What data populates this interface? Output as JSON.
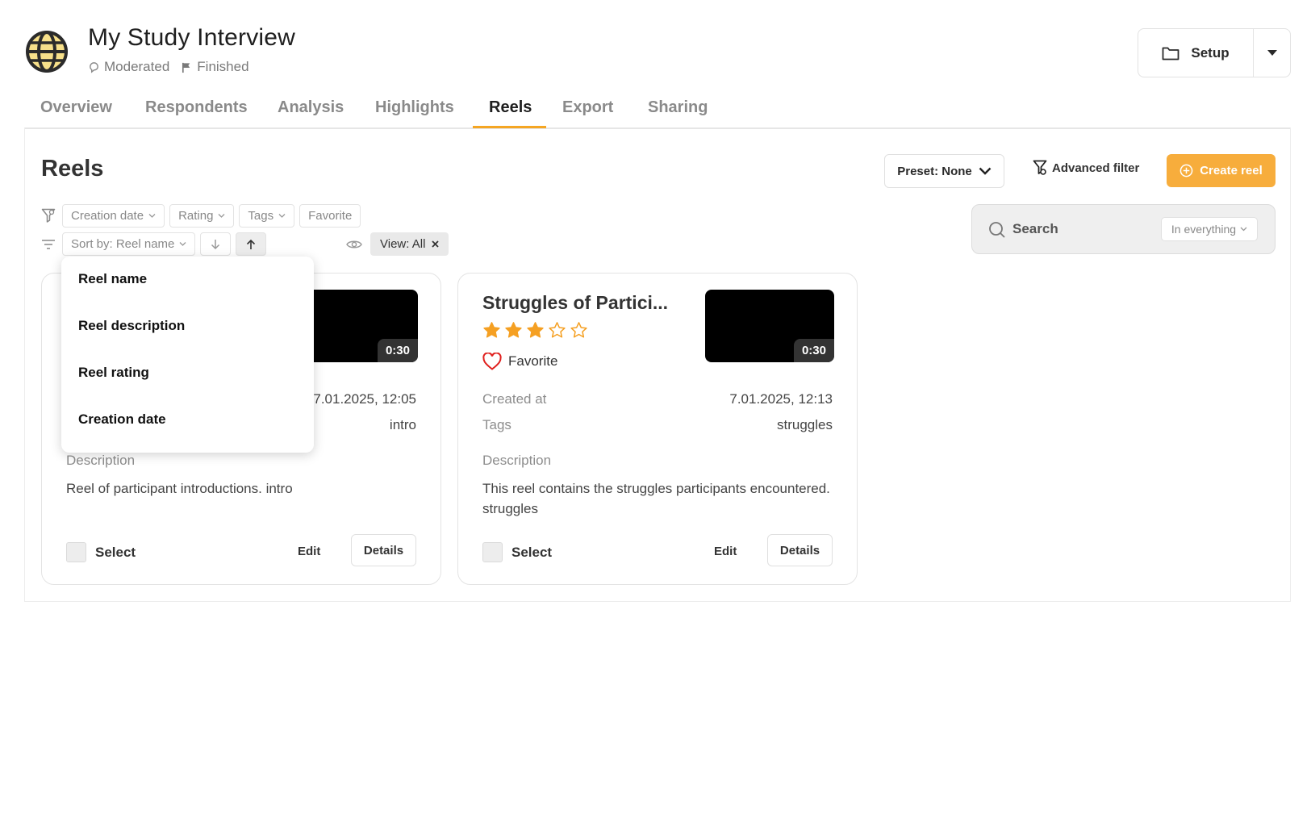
{
  "header": {
    "title": "My Study Interview",
    "meta": [
      {
        "icon": "moderated-icon",
        "label": "Moderated"
      },
      {
        "icon": "flag-icon",
        "label": "Finished"
      }
    ],
    "setup_label": "Setup"
  },
  "tabs": [
    {
      "label": "Overview",
      "active": false
    },
    {
      "label": "Respondents",
      "active": false
    },
    {
      "label": "Analysis",
      "active": false
    },
    {
      "label": "Highlights",
      "active": false
    },
    {
      "label": "Reels",
      "active": true
    },
    {
      "label": "Export",
      "active": false
    },
    {
      "label": "Sharing",
      "active": false
    }
  ],
  "page": {
    "title": "Reels",
    "preset_label": "Preset: None",
    "advanced_filter_label": "Advanced filter",
    "create_label": "Create reel"
  },
  "filters": {
    "chips": [
      "Creation date",
      "Rating",
      "Tags",
      "Favorite"
    ],
    "sort_label": "Sort by: Reel name",
    "view_label": "View: All"
  },
  "search": {
    "placeholder": "Search",
    "scope": "In everything"
  },
  "sort_dropdown": {
    "items": [
      "Reel name",
      "Reel description",
      "Reel rating",
      "Creation date"
    ]
  },
  "cards": [
    {
      "title": "",
      "duration": "0:30",
      "created_label": "",
      "created_value": "7.01.2025, 12:05",
      "tags_label": "",
      "tags_value": "intro",
      "description_label": "Description",
      "description": "Reel of participant introductions. intro",
      "select_label": "Select",
      "edit_label": "Edit",
      "details_label": "Details"
    },
    {
      "title": "Struggles of Partici...",
      "duration": "0:30",
      "rating": 3,
      "rating_max": 5,
      "favorite_label": "Favorite",
      "created_label": "Created at",
      "created_value": "7.01.2025, 12:13",
      "tags_label": "Tags",
      "tags_value": "struggles",
      "description_label": "Description",
      "description": "This reel contains the struggles participants encountered. struggles",
      "select_label": "Select",
      "edit_label": "Edit",
      "details_label": "Details"
    }
  ],
  "colors": {
    "accent": "#f5a623",
    "create_button": "#f7ad3c",
    "star": "#f5a023",
    "heart": "#e0201e"
  }
}
